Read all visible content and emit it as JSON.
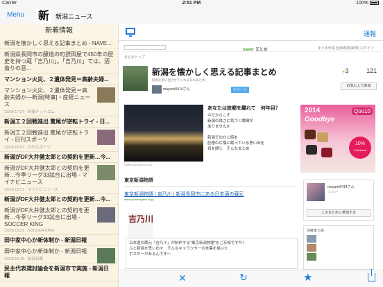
{
  "status_bar": {
    "carrier": "Carrier",
    "time": "2:51 PM",
    "battery": "100%"
  },
  "header": {
    "menu_label": "Menu",
    "logo_text": "新",
    "app_title": "新潟ニュース"
  },
  "sidebar": {
    "title": "新着情報",
    "items": [
      {
        "title": "新潟を懐かしく思える記事まとめ - NAVE...",
        "meta": "",
        "light": true
      },
      {
        "title": "新潟県長岡市の醸造の町摂田屋で450年の歴史を持つ蔵「吉乃川」。「吉乃川」では、酒造りの意...",
        "meta": "",
        "light": true
      },
      {
        "title": "マンション火災、２遺体発見＝高齢夫婦...",
        "meta": "",
        "light": false
      },
      {
        "title": "マンション火災、２遺体発見＝高齢夫婦か―新潟[時事]・産経ニュース",
        "meta": "12/28 17:37 · 時事ドットコム",
        "light": true
      },
      {
        "title": "新潟工２回戦進出 驚尾が逆転トライ - 日...",
        "meta": "",
        "light": false
      },
      {
        "title": "新潟工２回戦進出 驚尾が逆転トライ - 日刊スポーツ",
        "meta": "12/28 15:07 · 日刊スポーツ",
        "light": true
      },
      {
        "title": "新潟がDF大井健太郎との契約を更新…今...",
        "meta": "",
        "light": false
      },
      {
        "title": "新潟がDF大井健太郎との契約を更新…今季リーグ33試合に出場 - マイナビニュース",
        "meta": "12/28 15:21 · マイナビニュース",
        "light": true
      },
      {
        "title": "新潟がDF大井健太郎との契約を更新…今...",
        "meta": "",
        "light": false
      },
      {
        "title": "新潟がDF大井健太郎との契約を更新…今季リーグ33試合に出場 - SOCCER KING",
        "meta": "12/28 15:21 · SOCCER KING",
        "light": true
      },
      {
        "title": "田中家中心か新体制か - 新潟日報",
        "meta": "",
        "light": false
      },
      {
        "title": "田中家中心か新体制か - 新潟日報",
        "meta": "12/28 15:16 · 新潟日報",
        "light": true
      },
      {
        "title": "民主代表選討論会を新潟市で実施 - 新潟日報",
        "meta": "",
        "light": false
      }
    ]
  },
  "panel": {
    "share_label": "通報",
    "web": {
      "site_name": "naverまとめ",
      "site_brand": "naver",
      "site_suffix": "まとめ",
      "top_links": "まとめ作成  全新着順(新規)  ログイン",
      "breadcrumb": "まとめトップ",
      "headline": "新潟を懐かしく思える記事まとめ",
      "desc": "新潟を思い出させてくれるものまとめ",
      "author": "mayumi0414さん",
      "tweet": "ツイート",
      "rating_value": "3",
      "views_value": "121",
      "fav_label": "お気に入り追加",
      "poem_question": "あなたは故郷を離れて　何年目？",
      "poem_lines": [
        "今だからこそ",
        "新潟の良さに気づく瞬間が",
        "ありませんか",
        "",
        "新潟でのひと時を",
        "記憶の片隅に眠っている思い出を",
        "目を閉じ　そんなまとめ"
      ],
      "night_caption": "出典 blogs.yahoo.co.jp",
      "ad": {
        "year": "2014",
        "word": "Goodbye",
        "brand": "Qoo10",
        "percent": "10%",
        "cashback": "Cashback"
      },
      "section_title": "東京新潟物語",
      "link_title": "東京新潟物語 | 吉乃川 | 新潟長岡市にある日本酒の蔵元",
      "link_url": "www.yoshinogawa.co.jp",
      "sake_logo": "吉乃川",
      "sake_text": [
        "日本酒の蔵元「吉乃川」が制作する\"東京新潟物語\"をご存知ですか？",
        "ふと新潟を思い出す　そんなキャラクターの言葉を描いた",
        "ポスターがあるんです～"
      ],
      "card_name": "mayumi0414さん",
      "card_sub": "フォロー",
      "card_button": "このまとめに参加する",
      "list_title": "注目まとめ"
    },
    "toolbar": {
      "close": "✕",
      "reload": "↻",
      "star": "★"
    }
  }
}
